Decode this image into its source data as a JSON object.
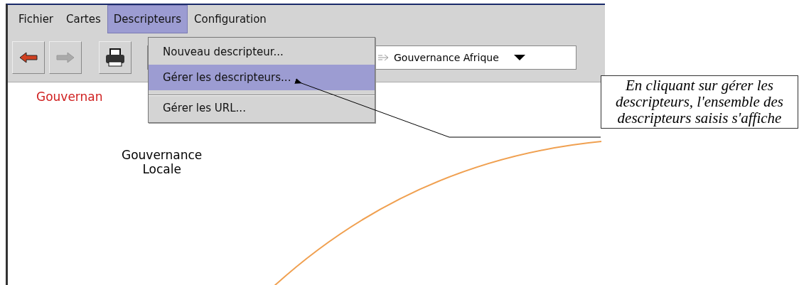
{
  "menu_bar": [
    {
      "label": "Fichier",
      "selected": false
    },
    {
      "label": "Cartes",
      "selected": false
    },
    {
      "label": "Descripteurs",
      "selected": true
    },
    {
      "label": "Configuration",
      "selected": false
    }
  ],
  "toolbar": {
    "buttons": [
      {
        "kind": "back",
        "disabled": false
      },
      {
        "kind": "forward",
        "disabled": true
      },
      {
        "kind": "print",
        "disabled": false
      }
    ],
    "map_select": {
      "value": "Gouvernance Afrique"
    }
  },
  "dropdown_menu": [
    {
      "label": "Nouveau descripteur...",
      "selected": false,
      "separator_before": false
    },
    {
      "label": "Gérer les descripteurs...",
      "selected": true,
      "separator_before": false
    },
    {
      "label": "Gérer les URL...",
      "selected": false,
      "separator_before": true
    }
  ],
  "canvas": {
    "title": "Gouvernan",
    "nodes": [
      {
        "lines": [
          "Gouvernance",
          "Locale"
        ]
      }
    ]
  },
  "callout": {
    "text": "En cliquant sur gérer les descripteurs, l'ensemble des descripteurs saisis s'affiche"
  }
}
